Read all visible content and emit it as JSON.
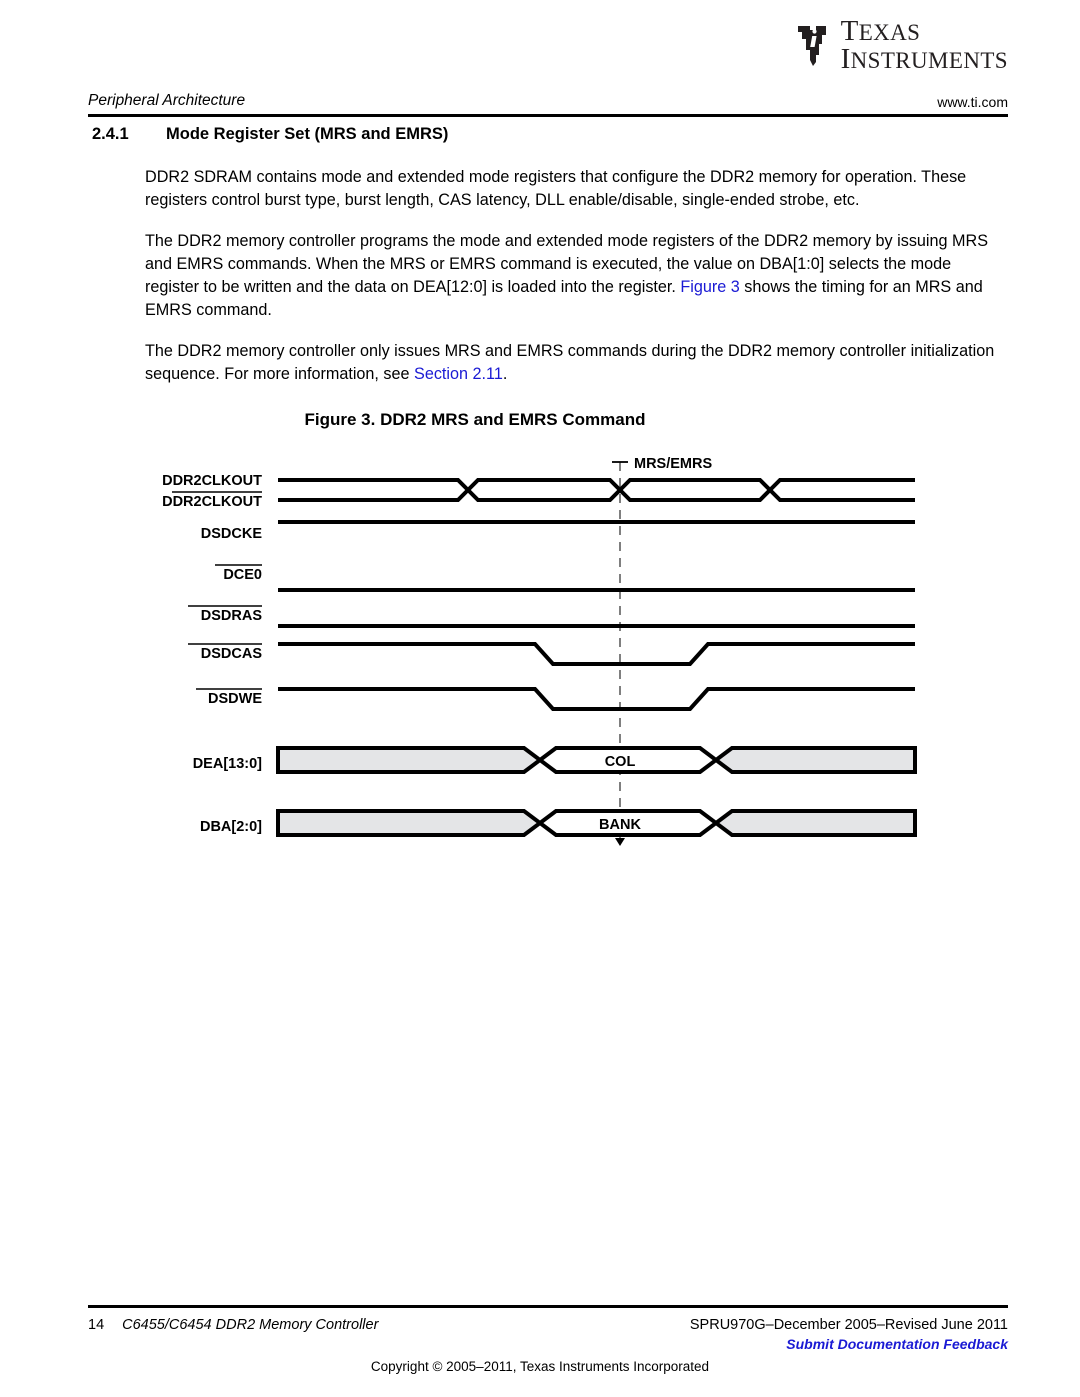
{
  "header": {
    "left_title": "Peripheral Architecture",
    "right_url": "www.ti.com",
    "logo_line1": "Texas",
    "logo_line2": "Instruments"
  },
  "section": {
    "number": "2.4.1",
    "title": "Mode Register Set (MRS and EMRS)"
  },
  "paragraphs": {
    "p1": "DDR2 SDRAM contains mode and extended mode registers that configure the DDR2 memory for operation. These registers control burst type, burst length, CAS latency, DLL enable/disable, single-ended strobe, etc.",
    "p2_a": "The DDR2 memory controller programs the mode and extended mode registers of the DDR2 memory by issuing MRS and EMRS commands. When the MRS or EMRS command is executed, the value on DBA[1:0] selects the mode register to be written and the data on DEA[12:0] is loaded into the register. ",
    "p2_link": "Figure 3",
    "p2_b": " shows the timing for an MRS and EMRS command.",
    "p3_a": "The DDR2 memory controller only issues MRS and EMRS commands during the DDR2 memory controller initialization sequence. For more information, see ",
    "p3_link": "Section 2.11",
    "p3_b": "."
  },
  "figure": {
    "caption": "Figure 3. DDR2 MRS and EMRS Command",
    "marker_label": "MRS/EMRS",
    "signals": [
      {
        "label": "DDR2CLKOUT",
        "overline": false
      },
      {
        "label": "DDR2CLKOUT",
        "overline": true
      },
      {
        "label": "DSDCKE",
        "overline": false
      },
      {
        "label": "DCE0",
        "overline": true
      },
      {
        "label": "DSDRAS",
        "overline": true
      },
      {
        "label": "DSDCAS",
        "overline": true
      },
      {
        "label": "DSDWE",
        "overline": true
      },
      {
        "label": "DEA[13:0]",
        "overline": false
      },
      {
        "label": "DBA[2:0]",
        "overline": false
      }
    ],
    "bus_values": {
      "dea": "COL",
      "dba": "BANK"
    }
  },
  "footer": {
    "page_number": "14",
    "doc_title": "C6455/C6454 DDR2 Memory Controller",
    "doc_id": "SPRU970G–December 2005–Revised June 2011",
    "feedback_link": "Submit Documentation Feedback",
    "copyright": "Copyright © 2005–2011, Texas Instruments Incorporated"
  },
  "colors": {
    "link": "#1a1ad4",
    "bus_fill": "#e4e5e7",
    "line": "#000000"
  }
}
